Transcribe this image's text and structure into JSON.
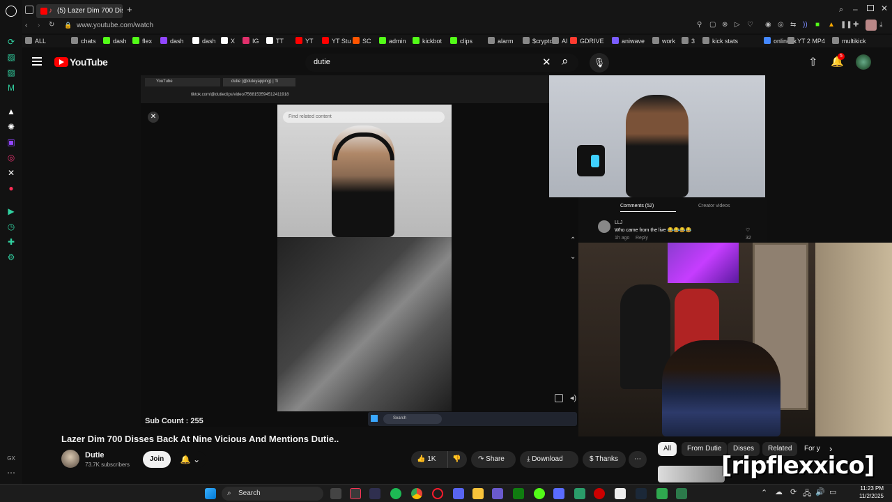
{
  "browser": {
    "tab_title": "(5) Lazer Dim 700 Dis",
    "url": "www.youtube.com/watch",
    "new_tab": "+"
  },
  "bookmarks": [
    {
      "label": "ALL",
      "color": "#888888"
    },
    {
      "label": "chats",
      "color": "#888888"
    },
    {
      "label": "dash",
      "color": "#53fc18"
    },
    {
      "label": "flex",
      "color": "#53fc18"
    },
    {
      "label": "dash",
      "color": "#9146ff"
    },
    {
      "label": "dash",
      "color": "#ffffff"
    },
    {
      "label": "X",
      "color": "#ffffff"
    },
    {
      "label": "IG",
      "color": "#e1306c"
    },
    {
      "label": "TT",
      "color": "#ffffff"
    },
    {
      "label": "YT",
      "color": "#ff0000"
    },
    {
      "label": "YT Stu",
      "color": "#ff0000"
    },
    {
      "label": "SC",
      "color": "#ff5500"
    },
    {
      "label": "admin",
      "color": "#53fc18"
    },
    {
      "label": "kickbot",
      "color": "#53fc18"
    },
    {
      "label": "clips",
      "color": "#53fc18"
    },
    {
      "label": "alarm",
      "color": "#888888"
    },
    {
      "label": "$crypto",
      "color": "#888888"
    },
    {
      "label": "AI",
      "color": "#888888"
    },
    {
      "label": "GDRIVE",
      "color": "#ff3b30"
    },
    {
      "label": "aniwave",
      "color": "#7a5cff"
    },
    {
      "label": "work",
      "color": "#888888"
    },
    {
      "label": "3",
      "color": "#888888"
    },
    {
      "label": "kick stats",
      "color": "#888888"
    },
    {
      "label": "onlinefix",
      "color": "#4488ff"
    },
    {
      "label": "YT 2 MP4",
      "color": "#888888"
    },
    {
      "label": "multikick",
      "color": "#888888"
    }
  ],
  "youtube": {
    "logo_text": "YouTube",
    "search_value": "dutie",
    "notif_count": "5"
  },
  "video": {
    "inner_tab1": "YouTube",
    "inner_tab2": "dutie (@duteyapping) | Ti",
    "inner_url": "tiktok.com/@dutieclips/video/7568153594512411918",
    "tiktok_search_placeholder": "Find related content",
    "comments_tab": "Comments (52)",
    "creator_tab": "Creator videos",
    "comment_user": "LLJ",
    "comment_text": "Who came from the live 😂😂😂😂",
    "comment_time": "1h ago",
    "comment_reply": "Reply",
    "comment_likes": "32",
    "sub_count": "Sub Count : 255",
    "mini_search": "Search"
  },
  "info": {
    "title": "Lazer Dim 700 Disses Back At Nine Vicious And Mentions Dutie..",
    "channel": "Dutie",
    "subscribers": "73.7K subscribers",
    "join": "Join",
    "likes": "1K",
    "share": "Share",
    "download": "Download",
    "thanks": "Thanks"
  },
  "chips": [
    "All",
    "From Dutie",
    "Disses",
    "Related",
    "For y"
  ],
  "watermark": "[ripflexxico]",
  "taskbar": {
    "search": "Search",
    "time": "11:23 PM",
    "date": "11/2/2025",
    "gx_label": "GX"
  }
}
